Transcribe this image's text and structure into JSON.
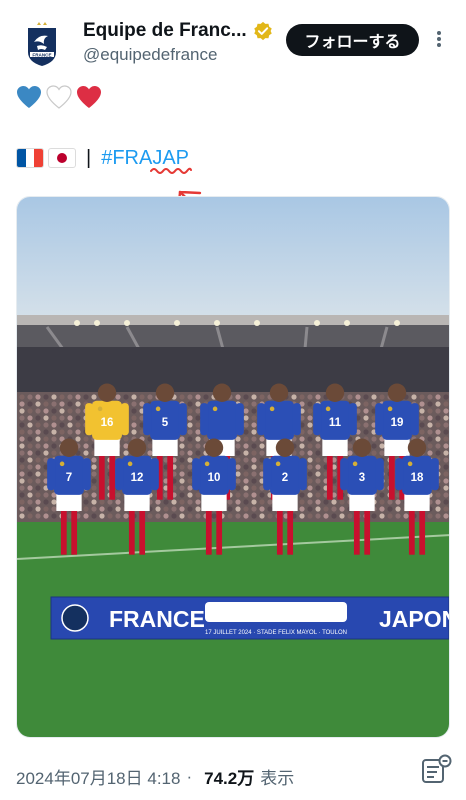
{
  "account": {
    "display_name": "Equipe de Franc...",
    "handle": "@equipedefrance",
    "crest_text": "FRANCE"
  },
  "follow_button": {
    "label": "フォローする"
  },
  "tweet": {
    "hearts": [
      "blue-heart-icon",
      "white-heart-icon",
      "red-heart-icon"
    ],
    "flags": [
      "france-flag-icon",
      "japan-flag-icon"
    ],
    "separator": "|",
    "hashtag": "#FRAJAP"
  },
  "media": {
    "banner_left": "FRANCE",
    "banner_right": "JAPON",
    "banner_middle": "17 JUILLET 2024 · STADE FELIX MAYOL · TOULON",
    "jersey_numbers": [
      "16",
      "5",
      "11",
      "19",
      "7",
      "12",
      "10",
      "2",
      "3",
      "18"
    ],
    "colors": {
      "jersey": "#2b4fb6",
      "shorts": "#ffffff",
      "socks": "#c8102e",
      "keeper": "#f2c230",
      "pitch": "#3f8a3a",
      "sky": "#a9c7e4"
    }
  },
  "meta": {
    "timestamp": "2024年07月18日 4:18",
    "separator": "·",
    "views_count": "74.2万",
    "views_label": "表示"
  },
  "colors": {
    "link": "#1d9bf0",
    "annotation": "#e53935",
    "verified": "#e2b719",
    "text_secondary": "#536471"
  }
}
